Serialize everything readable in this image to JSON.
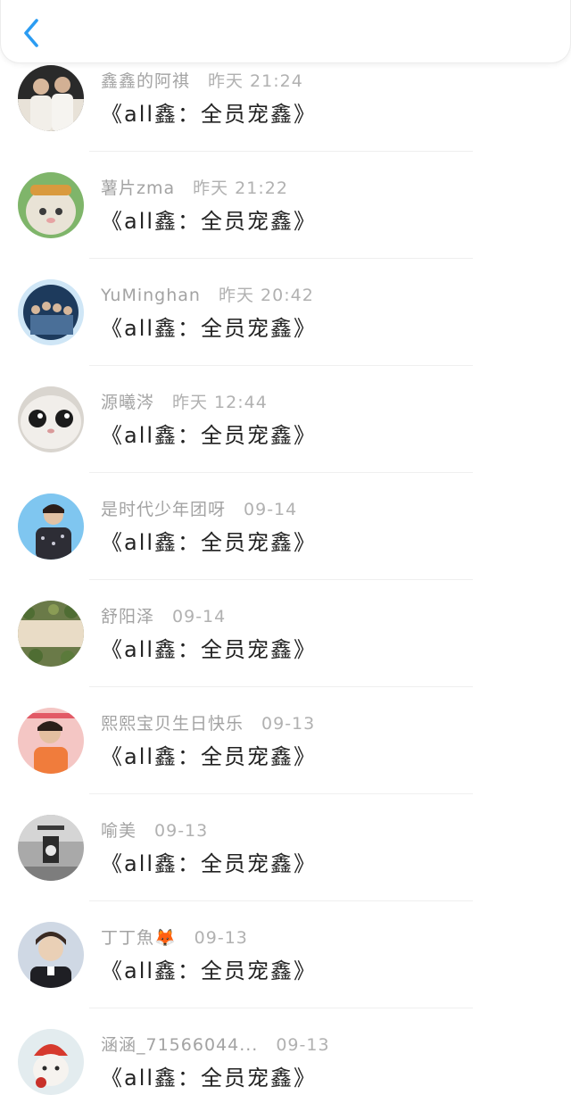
{
  "header": {
    "back_icon": "chevron-left-icon",
    "accent": "#2b9cf2"
  },
  "items": [
    {
      "name": "鑫鑫的阿祺",
      "time": "昨天 21:24",
      "title": "《all鑫：全员宠鑫》"
    },
    {
      "name": "薯片zma",
      "time": "昨天 21:22",
      "title": "《all鑫：全员宠鑫》"
    },
    {
      "name": "YuMinghan",
      "time": "昨天 20:42",
      "title": "《all鑫：全员宠鑫》"
    },
    {
      "name": "源曦涔",
      "time": "昨天 12:44",
      "title": "《all鑫：全员宠鑫》"
    },
    {
      "name": "是时代少年团呀",
      "time": "09-14",
      "title": "《all鑫：全员宠鑫》"
    },
    {
      "name": "舒阳泽",
      "time": "09-14",
      "title": "《all鑫：全员宠鑫》"
    },
    {
      "name": "熙熙宝贝生日快乐",
      "time": "09-13",
      "title": "《all鑫：全员宠鑫》"
    },
    {
      "name": "喻美",
      "time": "09-13",
      "title": "《all鑫：全员宠鑫》"
    },
    {
      "name": "丁丁魚🦊",
      "time": "09-13",
      "title": "《all鑫：全员宠鑫》"
    },
    {
      "name": "涵涵_71566044...",
      "time": "09-13",
      "title": "《all鑫：全员宠鑫》"
    }
  ]
}
